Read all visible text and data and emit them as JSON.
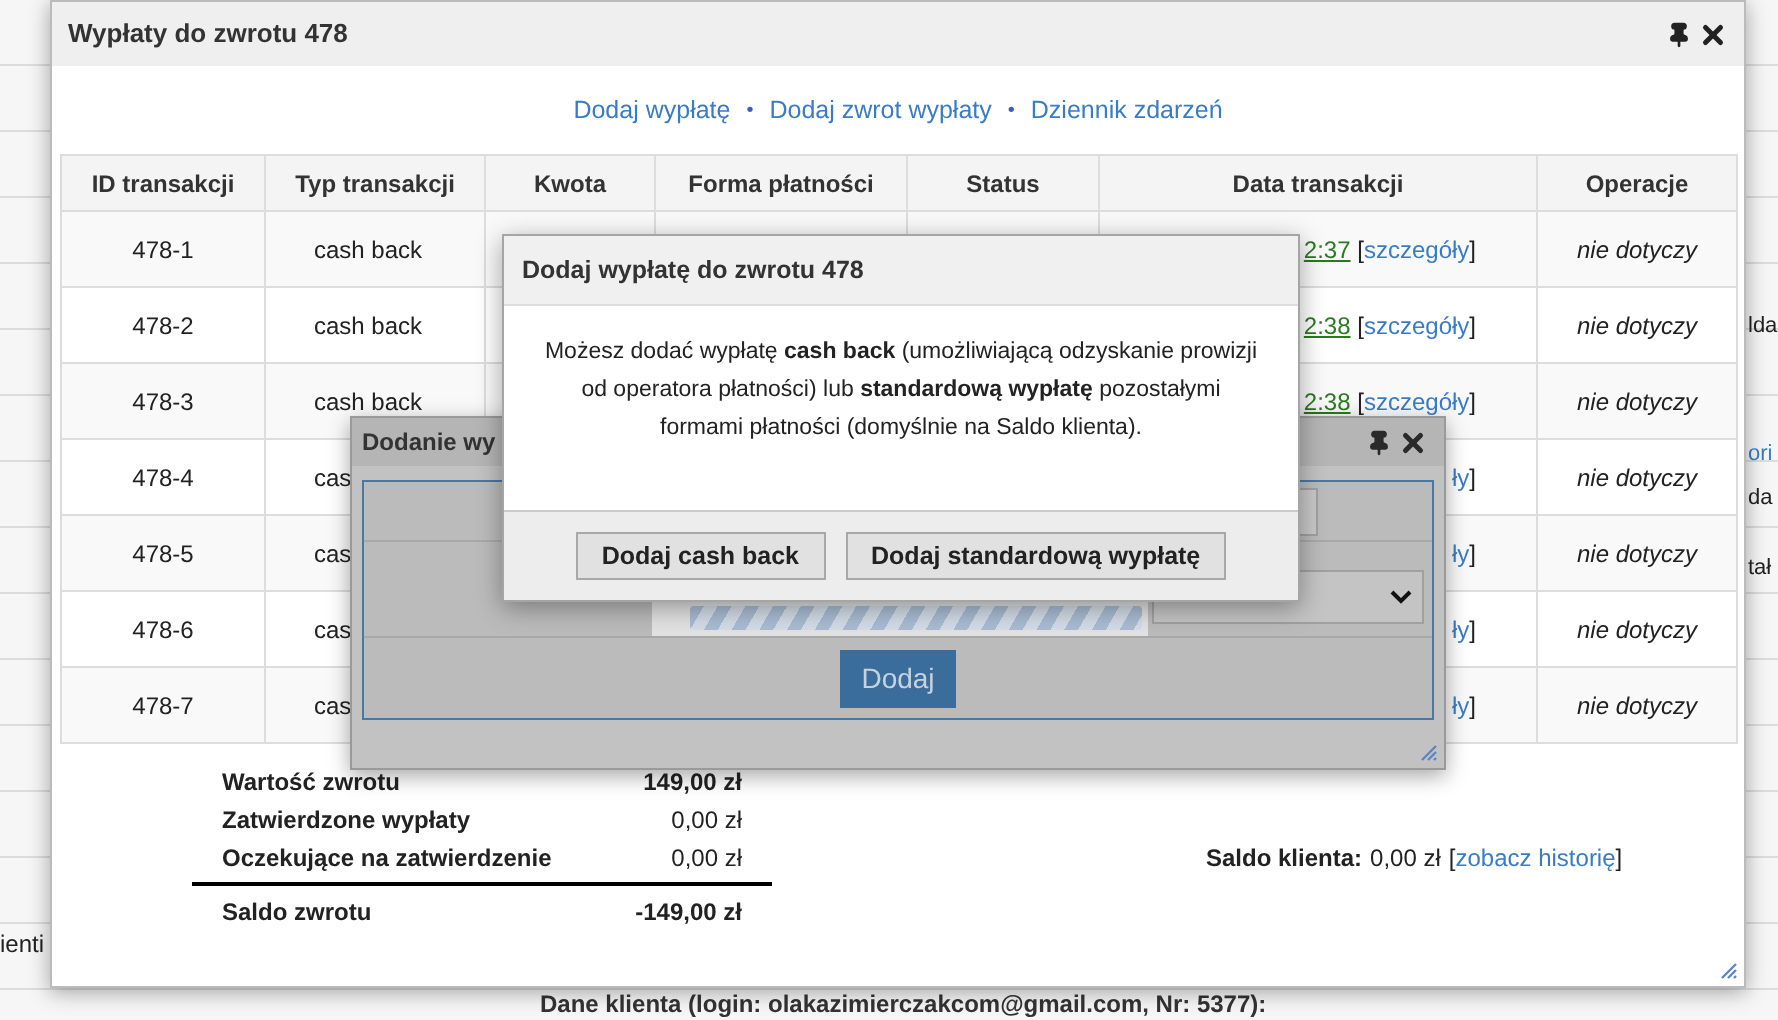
{
  "background": {
    "left_fragments": [
      {
        "text": "ienti"
      }
    ],
    "right_fragments": [
      {
        "kind": "text",
        "text": "lda"
      },
      {
        "kind": "link",
        "text": "ori"
      },
      {
        "kind": "text",
        "text": "da"
      },
      {
        "kind": "text",
        "text": "tał"
      }
    ],
    "footer_text": "Dane klienta (login: olakazimierczakcom@gmail.com, Nr: 5377):"
  },
  "main_dialog": {
    "title": "Wypłaty do zwrotu 478",
    "nav": [
      {
        "kind": "link",
        "text": "Dodaj wypłatę"
      },
      {
        "kind": "separator",
        "text": "•"
      },
      {
        "kind": "link",
        "text": "Dodaj zwrot wypłaty"
      },
      {
        "kind": "separator",
        "text": "•"
      },
      {
        "kind": "link",
        "text": "Dziennik zdarzeń"
      }
    ],
    "table": {
      "columns": [
        "ID transakcji",
        "Typ transakcji",
        "Kwota",
        "Forma płatności",
        "Status",
        "Data transakcji",
        "Operacje"
      ],
      "rows": [
        {
          "id": "478-1",
          "type": "cash back",
          "date": {
            "time": "2:37",
            "bracket_open": "[",
            "details": "szczegóły",
            "bracket_close": "]"
          },
          "operation": "nie dotyczy"
        },
        {
          "id": "478-2",
          "type": "cash back",
          "date": {
            "time": "2:38",
            "bracket_open": "[",
            "details": "szczegóły",
            "bracket_close": "]"
          },
          "operation": "nie dotyczy"
        },
        {
          "id": "478-3",
          "type": "cash back",
          "date": {
            "time": "2:38",
            "bracket_open": "[",
            "details": "szczegóły",
            "bracket_close": "]"
          },
          "operation": "nie dotyczy"
        },
        {
          "id": "478-4",
          "type": "cas",
          "date": {
            "details": "ły",
            "bracket_close": "]"
          },
          "operation": "nie dotyczy"
        },
        {
          "id": "478-5",
          "type": "cas",
          "date": {
            "details": "ły",
            "bracket_close": "]"
          },
          "operation": "nie dotyczy"
        },
        {
          "id": "478-6",
          "type": "cas",
          "date": {
            "details": "ły",
            "bracket_close": "]"
          },
          "operation": "nie dotyczy"
        },
        {
          "id": "478-7",
          "type": "cas",
          "date": {
            "details": "ły",
            "bracket_close": "]"
          },
          "operation": "nie dotyczy"
        }
      ]
    },
    "summary": {
      "rows": [
        {
          "label": "Wartość zwrotu",
          "value": "149,00 zł",
          "bold_value": true
        },
        {
          "label": "Zatwierdzone wypłaty",
          "value": "0,00 zł",
          "bold_value": false
        },
        {
          "label": "Oczekujące na zatwierdzenie",
          "value": "0,00 zł",
          "bold_value": false
        }
      ],
      "total": {
        "label": "Saldo zwrotu",
        "value": "-149,00 zł"
      }
    },
    "client_balance": {
      "label": "Saldo klienta:",
      "value": "0,00 zł",
      "bracket_open": "[",
      "link": "zobacz historię",
      "bracket_close": "]"
    }
  },
  "add_dialog": {
    "title": "Dodanie wy",
    "button": "Dodaj"
  },
  "choice_dialog": {
    "title": "Dodaj wypłatę do zwrotu 478",
    "message": "Możesz dodać wypłatę **cash back** (umożliwiającą odzyskanie prowizji od operatora płatności) lub **standardową wypłatę** pozostałymi formami płatności (domyślnie na Saldo klienta).",
    "buttons": [
      "Dodaj cash back",
      "Dodaj standardową wypłatę"
    ]
  }
}
